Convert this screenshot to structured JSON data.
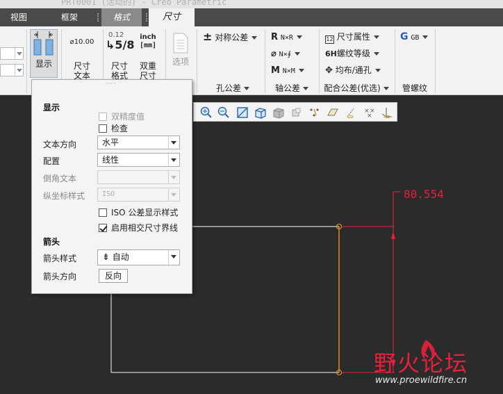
{
  "window": {
    "title_fragment": "PRT0001 (活动的) - Creo Parametric"
  },
  "tabs": [
    {
      "label": "视图"
    },
    {
      "label": "框架"
    },
    {
      "label": "格式"
    },
    {
      "label": "尺寸"
    }
  ],
  "ribbon": {
    "display_button": "显示",
    "dim_text_button": {
      "line1": "尺寸",
      "line2": "文本",
      "icon_text": "⌀10.00"
    },
    "dim_format_button": {
      "line1": "尺寸",
      "line2": "格式",
      "icon_top": "0.12",
      "icon_frac": "5/8"
    },
    "dual_dim_button": {
      "line1": "双重",
      "line2": "尺寸",
      "icon_top": "inch",
      "icon_bottom": "[mm]"
    },
    "options_button": "选项",
    "symmetric_tolerance": "对称公差",
    "hole_tolerance_group": "孔公差",
    "shaft_r": {
      "letter": "R",
      "text": "N×R"
    },
    "shaft_phi": {
      "letter": "⌀",
      "text": "N×∮"
    },
    "shaft_m": {
      "letter": "M",
      "text": "N×M"
    },
    "shaft_tolerance_group": "轴公差",
    "dim_properties": "尺寸属性",
    "thread_grade": {
      "prefix": "6H",
      "text": "螺纹等级"
    },
    "distribute_hole": "均布/通孔",
    "fit_tolerance_group": "配合公差(优选)",
    "gb_label": "GB",
    "pipe_thread_group": "管螺纹"
  },
  "panel": {
    "display_header": "显示",
    "dual_precision": "双精度值",
    "inspection": "检查",
    "text_direction_label": "文本方向",
    "text_direction_value": "水平",
    "config_label": "配置",
    "config_value": "线性",
    "chamfer_text_label": "倒角文本",
    "chamfer_text_value": "",
    "ordinate_style_label": "纵坐标样式",
    "ordinate_style_value": "ISO",
    "iso_tolerance_display": "ISO 公差显示样式",
    "intersecting_witness": "启用相交尺寸界线",
    "arrow_header": "箭头",
    "arrow_style_label": "箭头样式",
    "arrow_style_value": "自动",
    "arrow_direction_label": "箭头方向",
    "reverse_button": "反向"
  },
  "checkboxes": {
    "dual_precision": false,
    "inspection": false,
    "iso_tolerance_display": false,
    "intersecting_witness": true
  },
  "drawing": {
    "dimension_value": "80.554"
  },
  "watermark": {
    "logo": "野火论坛",
    "url": "www.proewildfire.cn"
  },
  "colors": {
    "dimension": "#e8213a",
    "selected_edge": "#f0a020",
    "geometry": "#ffffff",
    "canvas": "#2b2b2b"
  }
}
